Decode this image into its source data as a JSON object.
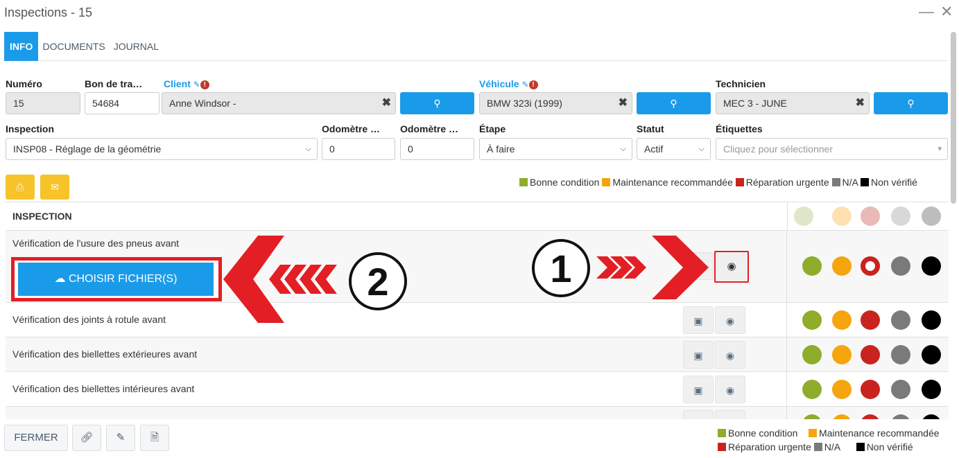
{
  "window": {
    "title": "Inspections - 15",
    "minimize": "—",
    "close": "✕"
  },
  "tabs": [
    "INFO",
    "DOCUMENTS",
    "JOURNAL"
  ],
  "form": {
    "numero": {
      "label": "Numéro",
      "value": "15"
    },
    "bon": {
      "label": "Bon de tra…",
      "value": "54684"
    },
    "client": {
      "label": "Client",
      "value": "Anne Windsor -"
    },
    "vehicule": {
      "label": "Véhicule",
      "value": "BMW 323i (1999)"
    },
    "technicien": {
      "label": "Technicien",
      "value": "MEC 3 - JUNE"
    },
    "inspection": {
      "label": "Inspection",
      "value": "INSP08 - Réglage de la géométrie"
    },
    "odo1": {
      "label": "Odomètre …",
      "value": "0"
    },
    "odo2": {
      "label": "Odomètre …",
      "value": "0"
    },
    "etape": {
      "label": "Étape",
      "value": "À faire"
    },
    "statut": {
      "label": "Statut",
      "value": "Actif"
    },
    "etiquettes": {
      "label": "Étiquettes",
      "placeholder": "Cliquez pour sélectionner"
    }
  },
  "legend": [
    {
      "label": "Bonne condition",
      "color": "#8fad2a"
    },
    {
      "label": "Maintenance recommandée",
      "color": "#f6a50f"
    },
    {
      "label": "Réparation urgente",
      "color": "#c9231f"
    },
    {
      "label": "N/A",
      "color": "#7a7a7a"
    },
    {
      "label": "Non vérifié",
      "color": "#000000"
    }
  ],
  "table": {
    "header": "INSPECTION",
    "rows": [
      "Vérification de l'usure des pneus avant",
      "Vérification des joints à rotule avant",
      "Vérification des biellettes extérieures avant",
      "Vérification des biellettes intérieures avant"
    ],
    "upload_label": "CHOISIR FICHIER(S)"
  },
  "annotations": {
    "one": "1",
    "two": "2"
  },
  "footer": {
    "close": "FERMER"
  },
  "colors": {
    "accent": "#1a9bea",
    "warning_button": "#f6c32a",
    "highlight": "#e31e24"
  }
}
